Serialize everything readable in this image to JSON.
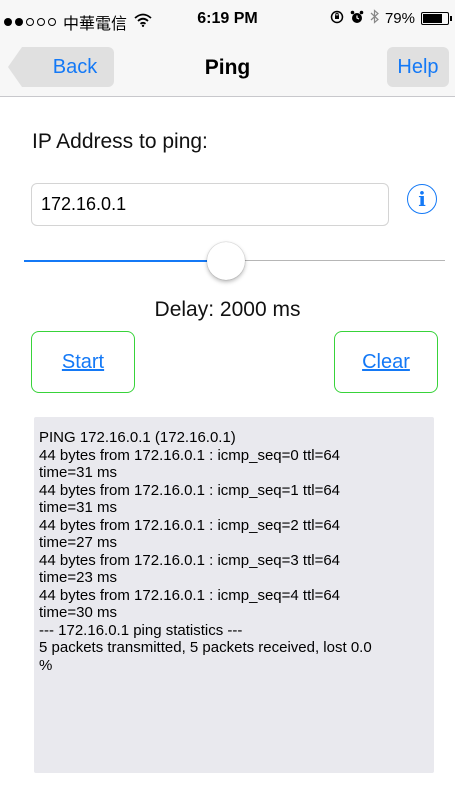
{
  "status_bar": {
    "signal_dots": [
      true,
      true,
      false,
      false,
      false
    ],
    "carrier": "中華電信",
    "wifi_icon": "wifi-icon",
    "time": "6:19 PM",
    "rotation_lock_icon": "rotation-lock-icon",
    "alarm_icon": "alarm-icon",
    "bluetooth_icon": "bluetooth-icon",
    "battery_percent": "79%",
    "battery_level": 0.79
  },
  "nav": {
    "back_label": "Back",
    "title": "Ping",
    "help_label": "Help"
  },
  "form": {
    "ip_label": "IP Address to ping:",
    "ip_value": "172.16.0.1",
    "info_icon": "info-icon",
    "slider_value": 0.48,
    "delay_text": "Delay: 2000 ms",
    "start_label": "Start",
    "clear_label": "Clear"
  },
  "output": {
    "text": "PING 172.16.0.1 (172.16.0.1)\n44 bytes from 172.16.0.1 : icmp_seq=0 ttl=64\ntime=31 ms\n44 bytes from 172.16.0.1 : icmp_seq=1 ttl=64\ntime=31 ms\n44 bytes from 172.16.0.1 : icmp_seq=2 ttl=64\ntime=27 ms\n44 bytes from 172.16.0.1 : icmp_seq=3 ttl=64\ntime=23 ms\n44 bytes from 172.16.0.1 : icmp_seq=4 ttl=64\ntime=30 ms\n--- 172.16.0.1 ping statistics ---\n5 packets transmitted, 5 packets received, lost 0.0\n%"
  },
  "colors": {
    "accent": "#1479f6",
    "button_border": "#38d33a",
    "output_bg": "#e9e9ee"
  }
}
